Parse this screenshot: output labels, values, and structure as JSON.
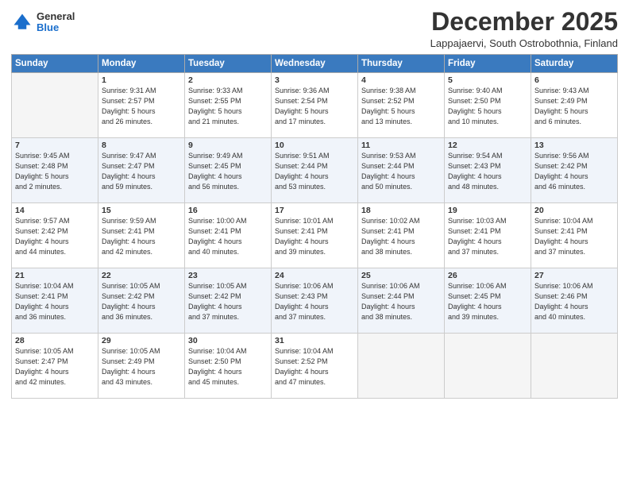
{
  "logo": {
    "general": "General",
    "blue": "Blue"
  },
  "header": {
    "month": "December 2025",
    "location": "Lappajaervi, South Ostrobothnia, Finland"
  },
  "weekdays": [
    "Sunday",
    "Monday",
    "Tuesday",
    "Wednesday",
    "Thursday",
    "Friday",
    "Saturday"
  ],
  "weeks": [
    [
      {
        "day": "",
        "info": ""
      },
      {
        "day": "1",
        "info": "Sunrise: 9:31 AM\nSunset: 2:57 PM\nDaylight: 5 hours\nand 26 minutes."
      },
      {
        "day": "2",
        "info": "Sunrise: 9:33 AM\nSunset: 2:55 PM\nDaylight: 5 hours\nand 21 minutes."
      },
      {
        "day": "3",
        "info": "Sunrise: 9:36 AM\nSunset: 2:54 PM\nDaylight: 5 hours\nand 17 minutes."
      },
      {
        "day": "4",
        "info": "Sunrise: 9:38 AM\nSunset: 2:52 PM\nDaylight: 5 hours\nand 13 minutes."
      },
      {
        "day": "5",
        "info": "Sunrise: 9:40 AM\nSunset: 2:50 PM\nDaylight: 5 hours\nand 10 minutes."
      },
      {
        "day": "6",
        "info": "Sunrise: 9:43 AM\nSunset: 2:49 PM\nDaylight: 5 hours\nand 6 minutes."
      }
    ],
    [
      {
        "day": "7",
        "info": "Sunrise: 9:45 AM\nSunset: 2:48 PM\nDaylight: 5 hours\nand 2 minutes."
      },
      {
        "day": "8",
        "info": "Sunrise: 9:47 AM\nSunset: 2:47 PM\nDaylight: 4 hours\nand 59 minutes."
      },
      {
        "day": "9",
        "info": "Sunrise: 9:49 AM\nSunset: 2:45 PM\nDaylight: 4 hours\nand 56 minutes."
      },
      {
        "day": "10",
        "info": "Sunrise: 9:51 AM\nSunset: 2:44 PM\nDaylight: 4 hours\nand 53 minutes."
      },
      {
        "day": "11",
        "info": "Sunrise: 9:53 AM\nSunset: 2:44 PM\nDaylight: 4 hours\nand 50 minutes."
      },
      {
        "day": "12",
        "info": "Sunrise: 9:54 AM\nSunset: 2:43 PM\nDaylight: 4 hours\nand 48 minutes."
      },
      {
        "day": "13",
        "info": "Sunrise: 9:56 AM\nSunset: 2:42 PM\nDaylight: 4 hours\nand 46 minutes."
      }
    ],
    [
      {
        "day": "14",
        "info": "Sunrise: 9:57 AM\nSunset: 2:42 PM\nDaylight: 4 hours\nand 44 minutes."
      },
      {
        "day": "15",
        "info": "Sunrise: 9:59 AM\nSunset: 2:41 PM\nDaylight: 4 hours\nand 42 minutes."
      },
      {
        "day": "16",
        "info": "Sunrise: 10:00 AM\nSunset: 2:41 PM\nDaylight: 4 hours\nand 40 minutes."
      },
      {
        "day": "17",
        "info": "Sunrise: 10:01 AM\nSunset: 2:41 PM\nDaylight: 4 hours\nand 39 minutes."
      },
      {
        "day": "18",
        "info": "Sunrise: 10:02 AM\nSunset: 2:41 PM\nDaylight: 4 hours\nand 38 minutes."
      },
      {
        "day": "19",
        "info": "Sunrise: 10:03 AM\nSunset: 2:41 PM\nDaylight: 4 hours\nand 37 minutes."
      },
      {
        "day": "20",
        "info": "Sunrise: 10:04 AM\nSunset: 2:41 PM\nDaylight: 4 hours\nand 37 minutes."
      }
    ],
    [
      {
        "day": "21",
        "info": "Sunrise: 10:04 AM\nSunset: 2:41 PM\nDaylight: 4 hours\nand 36 minutes."
      },
      {
        "day": "22",
        "info": "Sunrise: 10:05 AM\nSunset: 2:42 PM\nDaylight: 4 hours\nand 36 minutes."
      },
      {
        "day": "23",
        "info": "Sunrise: 10:05 AM\nSunset: 2:42 PM\nDaylight: 4 hours\nand 37 minutes."
      },
      {
        "day": "24",
        "info": "Sunrise: 10:06 AM\nSunset: 2:43 PM\nDaylight: 4 hours\nand 37 minutes."
      },
      {
        "day": "25",
        "info": "Sunrise: 10:06 AM\nSunset: 2:44 PM\nDaylight: 4 hours\nand 38 minutes."
      },
      {
        "day": "26",
        "info": "Sunrise: 10:06 AM\nSunset: 2:45 PM\nDaylight: 4 hours\nand 39 minutes."
      },
      {
        "day": "27",
        "info": "Sunrise: 10:06 AM\nSunset: 2:46 PM\nDaylight: 4 hours\nand 40 minutes."
      }
    ],
    [
      {
        "day": "28",
        "info": "Sunrise: 10:05 AM\nSunset: 2:47 PM\nDaylight: 4 hours\nand 42 minutes."
      },
      {
        "day": "29",
        "info": "Sunrise: 10:05 AM\nSunset: 2:49 PM\nDaylight: 4 hours\nand 43 minutes."
      },
      {
        "day": "30",
        "info": "Sunrise: 10:04 AM\nSunset: 2:50 PM\nDaylight: 4 hours\nand 45 minutes."
      },
      {
        "day": "31",
        "info": "Sunrise: 10:04 AM\nSunset: 2:52 PM\nDaylight: 4 hours\nand 47 minutes."
      },
      {
        "day": "",
        "info": ""
      },
      {
        "day": "",
        "info": ""
      },
      {
        "day": "",
        "info": ""
      }
    ]
  ]
}
